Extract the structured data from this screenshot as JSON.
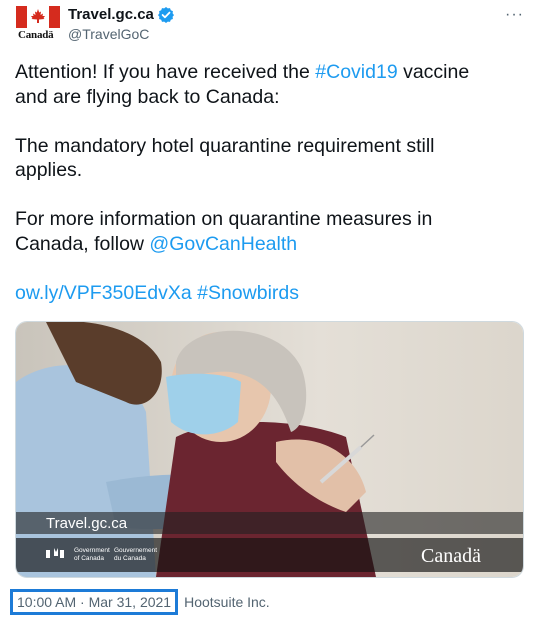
{
  "account": {
    "name": "Travel.gc.ca",
    "handle": "@TravelGoC",
    "logo_wordmark": "Canadä"
  },
  "more_label": "···",
  "tweet": {
    "line1_pre": "Attention! If you have received the ",
    "line1_hashtag": "#Covid19",
    "line1_post": " vaccine",
    "line2": "and are flying back to Canada:",
    "line3": "The mandatory hotel quarantine requirement still",
    "line4": "applies.",
    "line5": "For more information on quarantine measures in",
    "line6_pre": "Canada, follow ",
    "line6_mention": "@GovCanHealth",
    "short_link": "ow.ly/VPF350EdvXa",
    "hashtag2": "#Snowbirds"
  },
  "media": {
    "banner_text": "Travel.gc.ca",
    "gov_en_line1": "Government",
    "gov_en_line2": "of Canada",
    "gov_fr_line1": "Gouvernement",
    "gov_fr_line2": "du Canada",
    "wordmark": "Canadä"
  },
  "footer": {
    "timestamp": "10:00 AM · Mar 31, 2021",
    "source": "Hootsuite Inc."
  },
  "colors": {
    "accent": "#1d9bf0",
    "flag_red": "#d52b1e",
    "verified": "#1d9bf0"
  }
}
